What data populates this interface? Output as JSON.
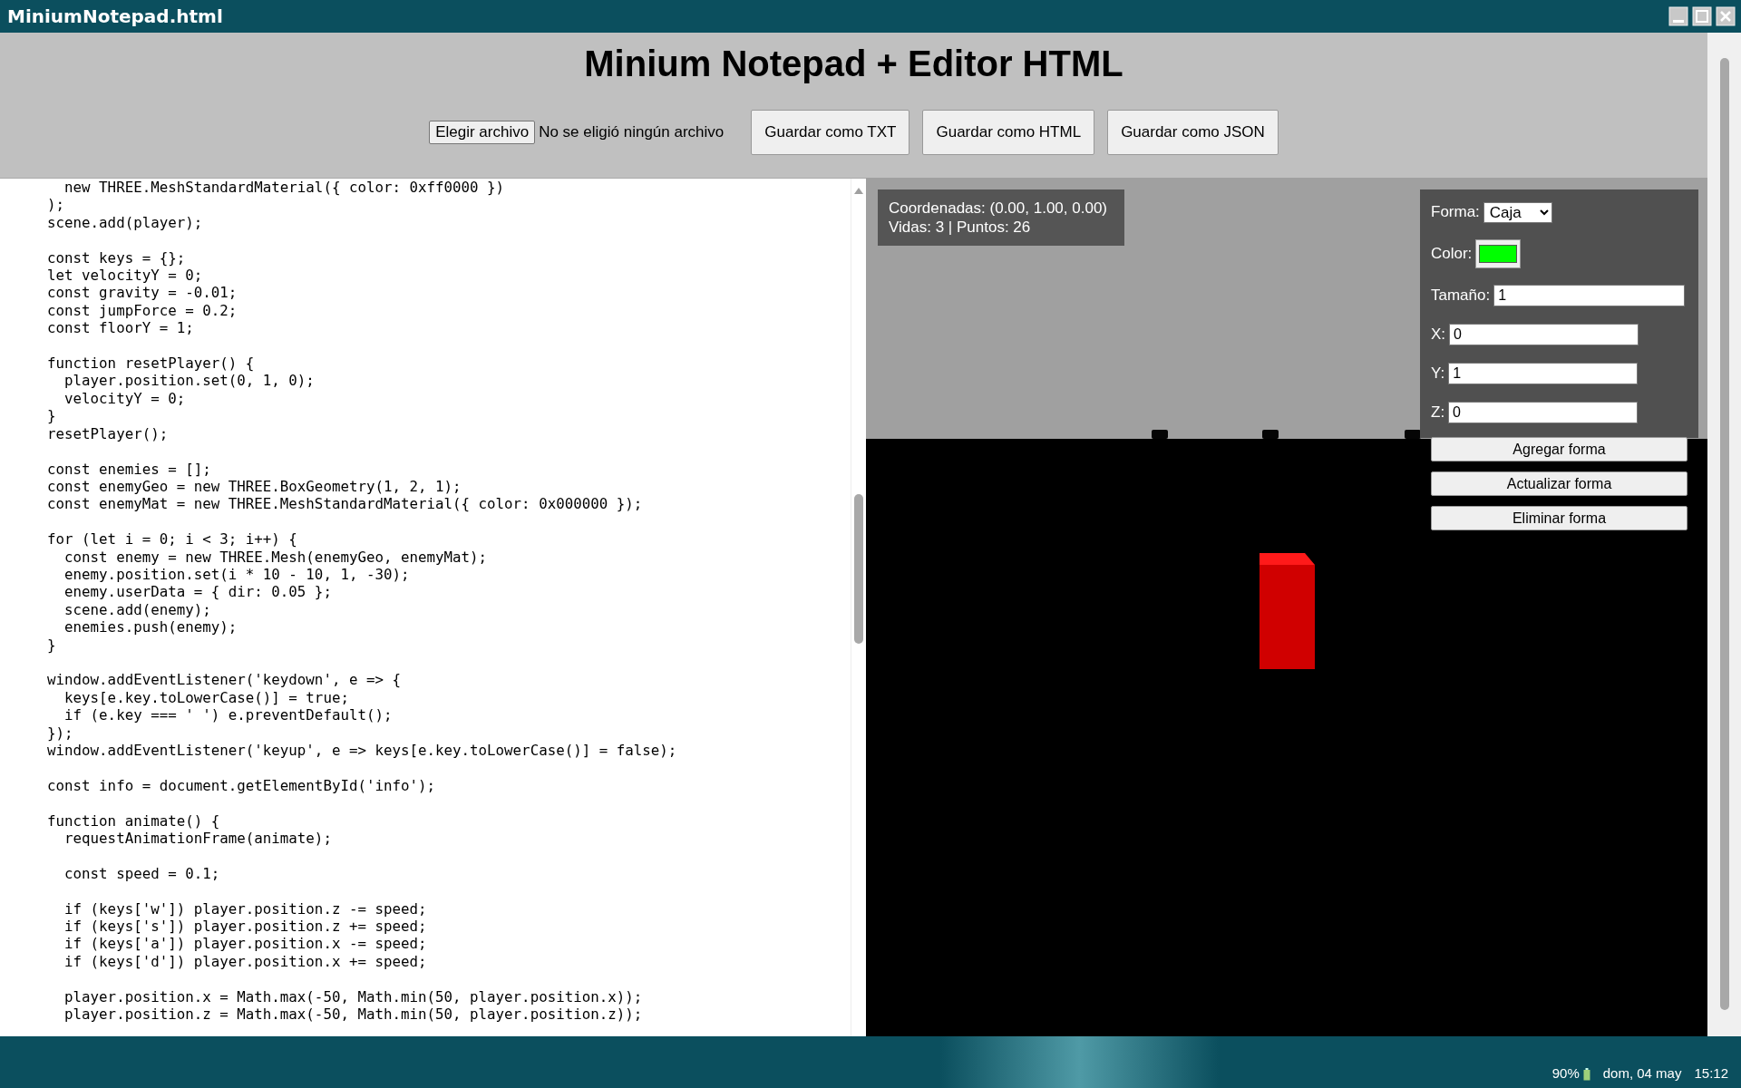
{
  "window": {
    "title": "MiniumNotepad.html"
  },
  "header": {
    "title": "Minium Notepad + Editor HTML",
    "file_button": "Elegir archivo",
    "file_status": "No se eligió ningún archivo",
    "buttons": [
      "Guardar como TXT",
      "Guardar como HTML",
      "Guardar como JSON"
    ]
  },
  "editor": {
    "blocks": [
      [
        "      new THREE.MeshStandardMaterial({ color: 0xff0000 })",
        "    );",
        "    scene.add(player);"
      ],
      [
        "    const keys = {};",
        "    let velocityY = 0;",
        "    const gravity = -0.01;",
        "    const jumpForce = 0.2;",
        "    const floorY = 1;"
      ],
      [
        "    function resetPlayer() {",
        "      player.position.set(0, 1, 0);",
        "      velocityY = 0;",
        "    }",
        "    resetPlayer();"
      ],
      [
        "    const enemies = [];",
        "    const enemyGeo = new THREE.BoxGeometry(1, 2, 1);",
        "    const enemyMat = new THREE.MeshStandardMaterial({ color: 0x000000 });"
      ],
      [
        "    for (let i = 0; i < 3; i++) {",
        "      const enemy = new THREE.Mesh(enemyGeo, enemyMat);",
        "      enemy.position.set(i * 10 - 10, 1, -30);",
        "      enemy.userData = { dir: 0.05 };",
        "      scene.add(enemy);",
        "      enemies.push(enemy);",
        "    }"
      ],
      [
        "    window.addEventListener('keydown', e => {",
        "      keys[e.key.toLowerCase()] = true;",
        "      if (e.key === ' ') e.preventDefault();",
        "    });",
        "    window.addEventListener('keyup', e => keys[e.key.toLowerCase()] = false);"
      ],
      [
        "    const info = document.getElementById('info');"
      ],
      [
        "    function animate() {",
        "      requestAnimationFrame(animate);"
      ],
      [
        "      const speed = 0.1;"
      ],
      [
        "      if (keys['w']) player.position.z -= speed;",
        "      if (keys['s']) player.position.z += speed;",
        "      if (keys['a']) player.position.x -= speed;",
        "      if (keys['d']) player.position.x += speed;"
      ],
      [
        "      player.position.x = Math.max(-50, Math.min(50, player.position.x));",
        "      player.position.z = Math.max(-50, Math.min(50, player.position.z));"
      ]
    ]
  },
  "viewport": {
    "info": [
      "Coordenadas: (0.00, 1.00, 0.00)",
      "Vidas: 3 | Puntos: 26"
    ],
    "panel": {
      "fields": [
        {
          "kind": "select",
          "label": "Forma:",
          "value": "Caja"
        },
        {
          "kind": "color",
          "label": "Color:",
          "color": "#00ff00"
        },
        {
          "kind": "text",
          "label": "Tamaño:",
          "value": "1"
        },
        {
          "kind": "text",
          "label": "X:",
          "value": "0"
        },
        {
          "kind": "text",
          "label": "Y:",
          "value": "1"
        },
        {
          "kind": "text",
          "label": "Z:",
          "value": "0"
        }
      ],
      "buttons": [
        "Agregar forma",
        "Actualizar forma",
        "Eliminar forma"
      ]
    }
  },
  "taskbar": {
    "battery": "90%",
    "date": "dom, 04 may",
    "time": "15:12"
  }
}
